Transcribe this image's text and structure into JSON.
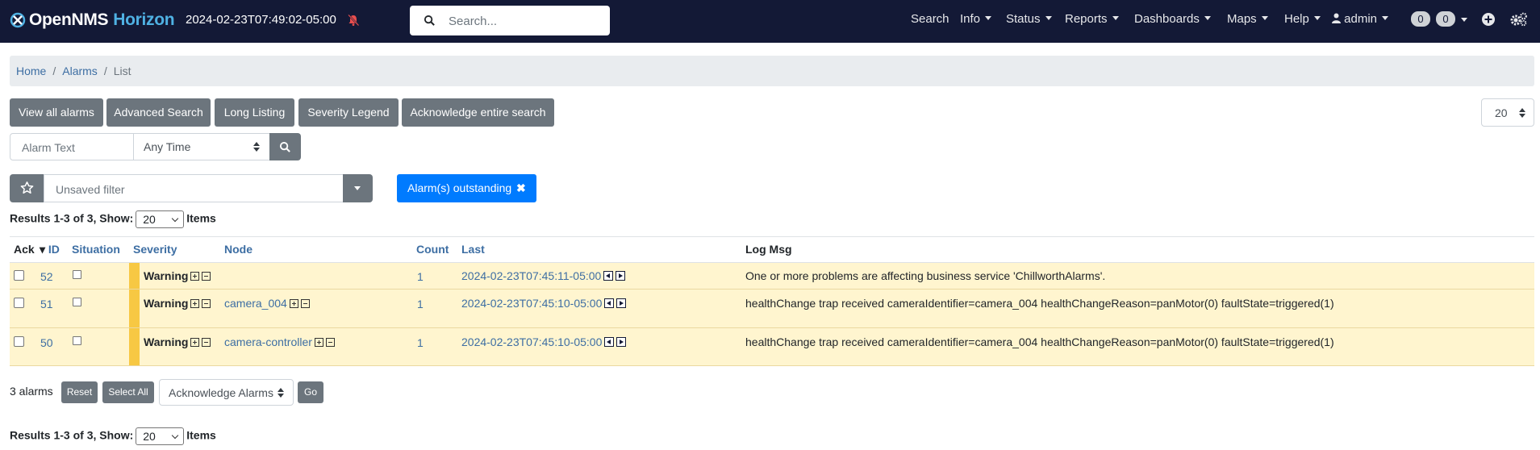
{
  "navbar": {
    "brand_open": "OpenNMS",
    "brand_horizon": "Horizon",
    "time": "2024-02-23T07:49:02-05:00",
    "search_placeholder": "Search...",
    "menu": [
      {
        "label": "Search",
        "dropdown": false
      },
      {
        "label": "Info",
        "dropdown": true
      },
      {
        "label": "Status",
        "dropdown": true
      },
      {
        "label": "Reports",
        "dropdown": true
      },
      {
        "label": "Dashboards",
        "dropdown": true
      },
      {
        "label": "Maps",
        "dropdown": true
      },
      {
        "label": "Help",
        "dropdown": true
      },
      {
        "label": "admin",
        "dropdown": true
      }
    ],
    "badge_1": "0",
    "badge_2": "0"
  },
  "breadcrumb": [
    "Home",
    "Alarms",
    "List"
  ],
  "toolbar": {
    "view_all": "View all alarms",
    "advanced_search": "Advanced Search",
    "long_listing": "Long Listing",
    "severity_legend": "Severity Legend",
    "acknowledge_search": "Acknowledge entire search",
    "page_size": "20"
  },
  "search": {
    "alarm_text_placeholder": "Alarm Text",
    "time_value": "Any Time"
  },
  "filter": {
    "placeholder": "Unsaved filter",
    "active_chip": "Alarm(s) outstanding"
  },
  "results": {
    "prefix": "Results 1-3 of 3, Show:",
    "show": "20",
    "suffix": "Items"
  },
  "table": {
    "headers": {
      "ack": "Ack",
      "id": "ID",
      "situation": "Situation",
      "severity": "Severity",
      "node": "Node",
      "count": "Count",
      "last": "Last",
      "logmsg": "Log Msg"
    },
    "sort_indicator": "▾",
    "rows": [
      {
        "id": "52",
        "severity": "Warning",
        "node": "",
        "count": "1",
        "last": "2024-02-23T07:45:11-05:00",
        "logmsg": "One or more problems are affecting business service 'ChillworthAlarms'."
      },
      {
        "id": "51",
        "severity": "Warning",
        "node": "camera_004",
        "count": "1",
        "last": "2024-02-23T07:45:10-05:00",
        "logmsg": "healthChange trap received cameraIdentifier=camera_004 healthChangeReason=panMotor(0) faultState=triggered(1)"
      },
      {
        "id": "50",
        "severity": "Warning",
        "node": "camera-controller",
        "count": "1",
        "last": "2024-02-23T07:45:10-05:00",
        "logmsg": "healthChange trap received cameraIdentifier=camera_004 healthChangeReason=panMotor(0) faultState=triggered(1)"
      }
    ]
  },
  "footer": {
    "count_label": "3 alarms",
    "reset": "Reset",
    "select_all": "Select All",
    "ack_action": "Acknowledge Alarms",
    "go": "Go"
  },
  "colors": {
    "navbar": "#131936",
    "brand_accent": "#4fb1e3",
    "warning_row": "#fff5cf",
    "warning_bar": "#f7c843",
    "primary": "#007bff",
    "secondary": "#6c757d"
  }
}
